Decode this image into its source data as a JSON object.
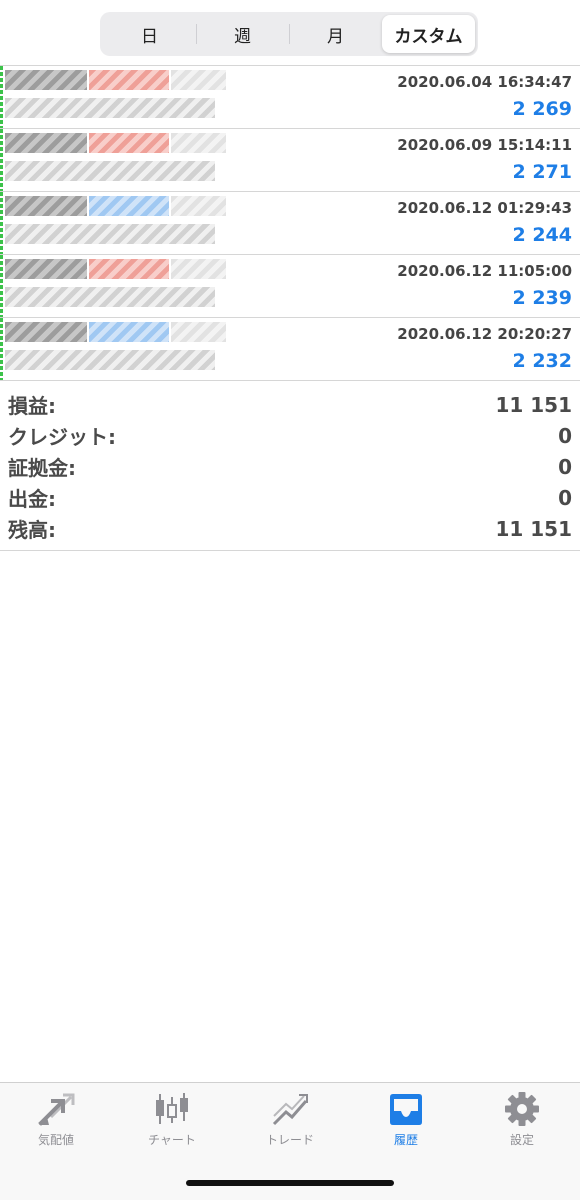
{
  "segments": [
    {
      "label": "日",
      "active": false
    },
    {
      "label": "週",
      "active": false
    },
    {
      "label": "月",
      "active": false
    },
    {
      "label": "カスタム",
      "active": true
    }
  ],
  "deals": [
    {
      "time": "2020.06.04 16:34:47",
      "profit": "2 269",
      "tag": "red"
    },
    {
      "time": "2020.06.09 15:14:11",
      "profit": "2 271",
      "tag": "red"
    },
    {
      "time": "2020.06.12 01:29:43",
      "profit": "2 244",
      "tag": "blue"
    },
    {
      "time": "2020.06.12 11:05:00",
      "profit": "2 239",
      "tag": "red"
    },
    {
      "time": "2020.06.12 20:20:27",
      "profit": "2 232",
      "tag": "blue"
    }
  ],
  "summary": [
    {
      "label": "損益:",
      "value": "11 151"
    },
    {
      "label": "クレジット:",
      "value": "0"
    },
    {
      "label": "証拠金:",
      "value": "0"
    },
    {
      "label": "出金:",
      "value": "0"
    },
    {
      "label": "残高:",
      "value": "11 151"
    }
  ],
  "tabs": [
    {
      "label": "気配値",
      "icon": "quotes-arrows-icon",
      "active": false
    },
    {
      "label": "チャート",
      "icon": "candlestick-chart-icon",
      "active": false
    },
    {
      "label": "トレード",
      "icon": "trade-trend-icon",
      "active": false
    },
    {
      "label": "履歴",
      "icon": "history-inbox-icon",
      "active": true
    },
    {
      "label": "設定",
      "icon": "gear-icon",
      "active": false
    }
  ],
  "colors": {
    "accent": "#1e7ee6",
    "profit": "#1e7ee6",
    "inactive": "#8e8e93",
    "deal_marker": "#3cc24a"
  }
}
